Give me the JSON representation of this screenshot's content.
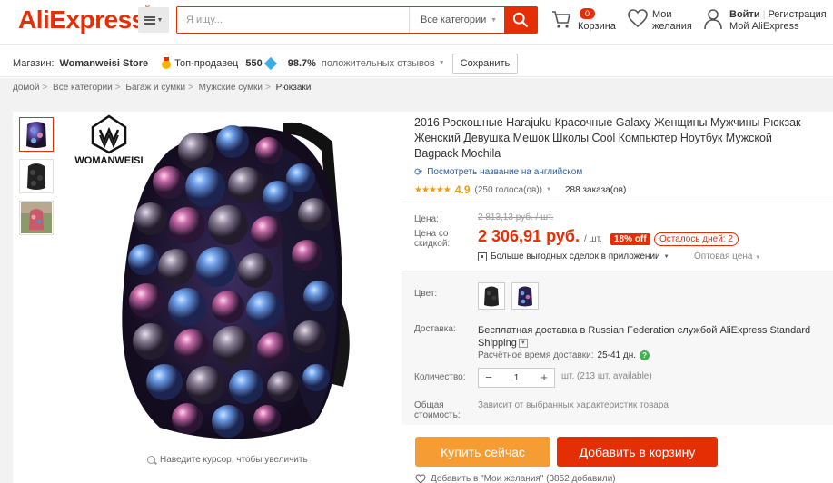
{
  "header": {
    "logo": "AliExpress",
    "logo_tm": "®",
    "search_placeholder": "Я ищу...",
    "search_category": "Все категории",
    "cart_count": "0",
    "cart_label": "Корзина",
    "wishlist_label_1": "Мои",
    "wishlist_label_2": "желания",
    "sign_in": "Войти",
    "register": "Регистрация",
    "my_account": "Мой AliExpress"
  },
  "store": {
    "label": "Магазин:",
    "name": "Womanweisi Store",
    "top_seller": "Топ-продавец",
    "score": "550",
    "percent": "98.7%",
    "reviews": "положительных отзывов",
    "save": "Сохранить"
  },
  "breadcrumb": [
    "домой",
    "Все категории",
    "Багаж и сумки",
    "Мужские сумки",
    "Рюкзаки"
  ],
  "breadcrumb_sep": ">",
  "gallery": {
    "brand": "WOMANWEISI",
    "zoom_hint": "Наведите курсор, чтобы увеличить"
  },
  "product": {
    "title": "2016 Роскошные Harajuku Красочные Galaxy Женщины Мужчины Рюкзак Женский Девушка Мешок Школы Cool Компьютер Ноутбук Мужской Bagpack Mochila",
    "translate": "Посмотреть название на английском",
    "stars": "★★★★★",
    "rating": "4.9",
    "votes": "(250 голоса(ов))",
    "orders": "288 заказа(ов)"
  },
  "price": {
    "label_price": "Цена:",
    "label_discount_1": "Цена со",
    "label_discount_2": "скидкой:",
    "old": "2 813,13 руб. / шт.",
    "new": "2 306,91 руб.",
    "unit": "/ шт.",
    "discount": "18% off",
    "days_left": "Осталось дней: 2",
    "app_deals": "Больше выгодных сделок в приложении",
    "wholesale": "Оптовая цена"
  },
  "options": {
    "color_label": "Цвет:",
    "shipping_label": "Доставка:",
    "shipping_text": "Бесплатная доставка в Russian Federation службой AliExpress Standard Shipping",
    "eta_label": "Расчётное время доставки:",
    "eta_value": "25-41 дн.",
    "qty_label": "Количество:",
    "qty_minus": "−",
    "qty_value": "1",
    "qty_plus": "+",
    "qty_note": "шт. (213 шт. available)",
    "total_label_1": "Общая",
    "total_label_2": "стоимость:",
    "total_note": "Зависит от выбранных характеристик товара"
  },
  "actions": {
    "buy_now": "Купить сейчас",
    "add_to_cart": "Добавить в корзину",
    "wishlist": "Добавить в \"Мои желания\" (3852 добавили)"
  },
  "colors": {
    "brand": "#e62e04",
    "buy_now": "#f69c35",
    "stars": "#f39c12",
    "link": "#2a5ea0"
  }
}
